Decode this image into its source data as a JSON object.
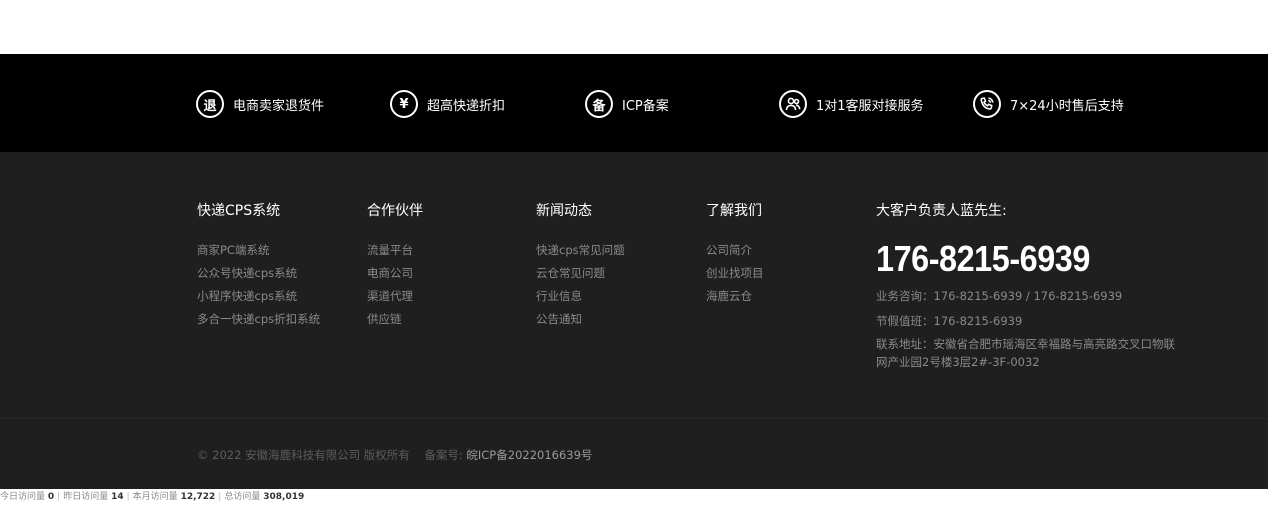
{
  "services": [
    {
      "icon": "退",
      "label": "电商卖家退货件"
    },
    {
      "icon": "¥",
      "label": "超高快递折扣"
    },
    {
      "icon": "备",
      "label": "ICP备案"
    },
    {
      "icon": "",
      "label": "1对1客服对接服务"
    },
    {
      "icon": "",
      "label": "7×24小时售后支持"
    }
  ],
  "columns": [
    {
      "title": "快递CPS系统",
      "links": [
        "商家PC端系统",
        "公众号快递cps系统",
        "小程序快递cps系统",
        "多合一快递cps折扣系统"
      ]
    },
    {
      "title": "合作伙伴",
      "links": [
        "流量平台",
        "电商公司",
        "渠道代理",
        "供应链"
      ]
    },
    {
      "title": "新闻动态",
      "links": [
        "快递cps常见问题",
        "云仓常见问题",
        "行业信息",
        "公告通知"
      ]
    },
    {
      "title": "了解我们",
      "links": [
        "公司简介",
        "创业找项目",
        "海鹿云仓"
      ]
    }
  ],
  "contact": {
    "title": "大客户负责人蓝先生:",
    "hotline": "176-8215-6939",
    "business": "业务咨询：176-8215-6939 / 176-8215-6939",
    "holiday": "节假值班：176-8215-6939",
    "address": "联系地址：安徽省合肥市瑶海区幸福路与高亮路交叉口物联网产业园2号楼3层2#-3F-0032"
  },
  "copyright": {
    "text": "© 2022 安徽海鹿科技有限公司 版权所有",
    "icp_label": "备案号:",
    "icp_number": "皖ICP备2022016639号"
  },
  "stats": {
    "today_label": "今日访问量",
    "today_value": "0",
    "yesterday_label": "昨日访问量",
    "yesterday_value": "14",
    "month_label": "本月访问量",
    "month_value": "12,722",
    "total_label": "总访问量",
    "total_value": "308,019"
  }
}
